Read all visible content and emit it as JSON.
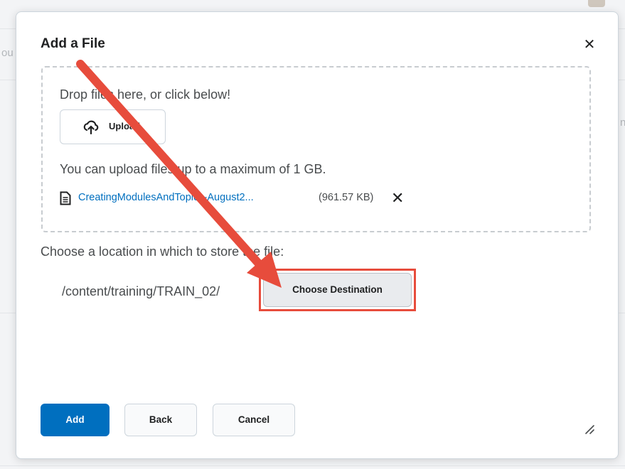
{
  "background": {
    "left_fragment": "ou",
    "right_fragment": "n"
  },
  "dialog": {
    "title": "Add a File",
    "close_icon": "close-icon",
    "dropzone": {
      "drop_text": "Drop files here, or click below!",
      "upload_label": "Upload",
      "upload_icon": "upload-cloud-icon",
      "limit_text": "You can upload files up to a maximum of 1 GB.",
      "file": {
        "icon": "document-icon",
        "name": "CreatingModulesAndTopics-August2...",
        "size": "(961.57 KB)",
        "remove_icon": "remove-x-icon"
      }
    },
    "location_label": "Choose a location in which to store the file:",
    "path": "/content/training/TRAIN_02/",
    "choose_destination_label": "Choose Destination",
    "buttons": {
      "add": "Add",
      "back": "Back",
      "cancel": "Cancel"
    },
    "resize_icon": "resize-handle-icon"
  },
  "annotation": {
    "arrow_color": "#e74c3c",
    "highlight_color": "#e74c3c"
  },
  "colors": {
    "primary": "#006fbf",
    "link": "#006fbf",
    "text": "#494c4e"
  }
}
